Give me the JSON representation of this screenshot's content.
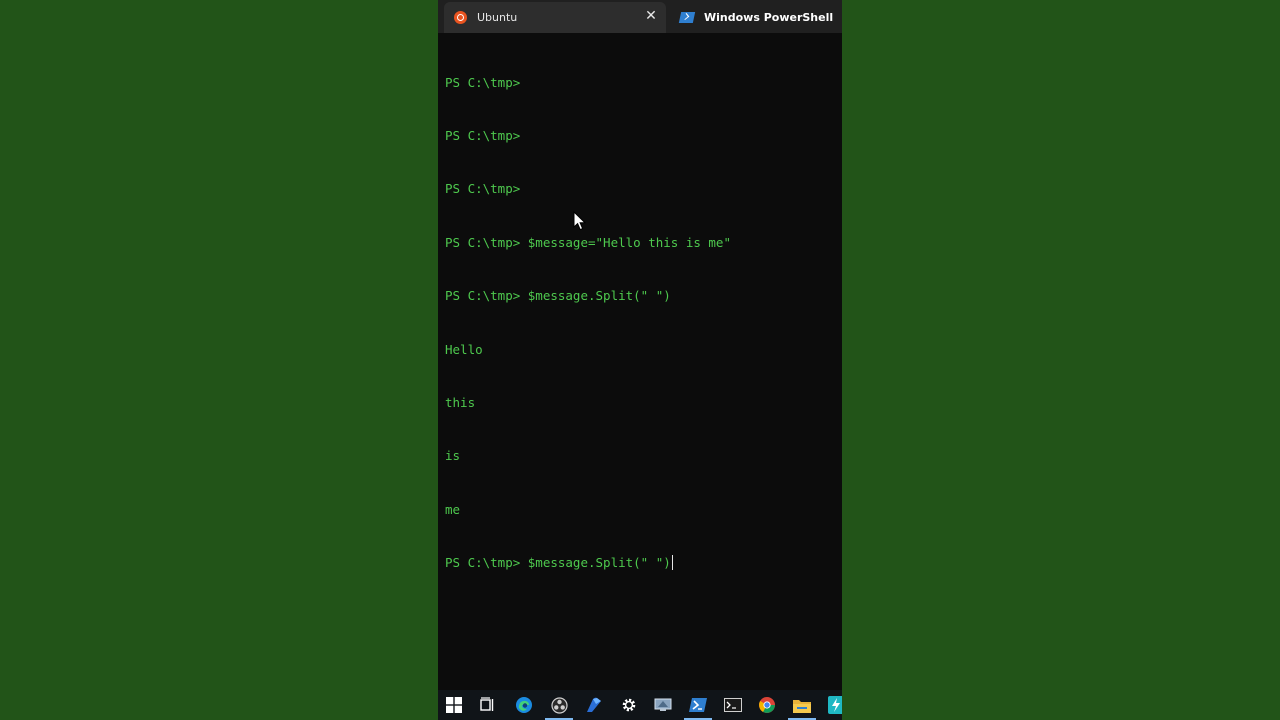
{
  "tabs": [
    {
      "label": "Ubuntu",
      "icon": "ubuntu-icon",
      "active": false
    },
    {
      "label": "Windows PowerShell",
      "icon": "powershell-icon",
      "active": true
    }
  ],
  "close_glyph": "✕",
  "terminal": {
    "lines": [
      "PS C:\\tmp>",
      "PS C:\\tmp>",
      "PS C:\\tmp>",
      "PS C:\\tmp> $message=\"Hello this is me\"",
      "PS C:\\tmp> $message.Split(\" \")",
      "Hello",
      "this",
      "is",
      "me"
    ],
    "current_input": "PS C:\\tmp> $message.Split(\" \")"
  },
  "colors": {
    "desktop_bg": "#225418",
    "terminal_bg": "#0c0c0c",
    "terminal_text": "#4ec94e",
    "tab_active": "#202020",
    "tab_inactive": "#2d2d2d"
  },
  "taskbar": {
    "icons": [
      "windows-start-icon",
      "task-view-icon",
      "edge-browser-icon",
      "obs-icon",
      "drawing-app-icon",
      "settings-gear-icon",
      "remote-desktop-icon",
      "powershell-taskbar-icon",
      "terminal-icon",
      "chrome-icon",
      "file-explorer-icon",
      "app-icon"
    ]
  }
}
